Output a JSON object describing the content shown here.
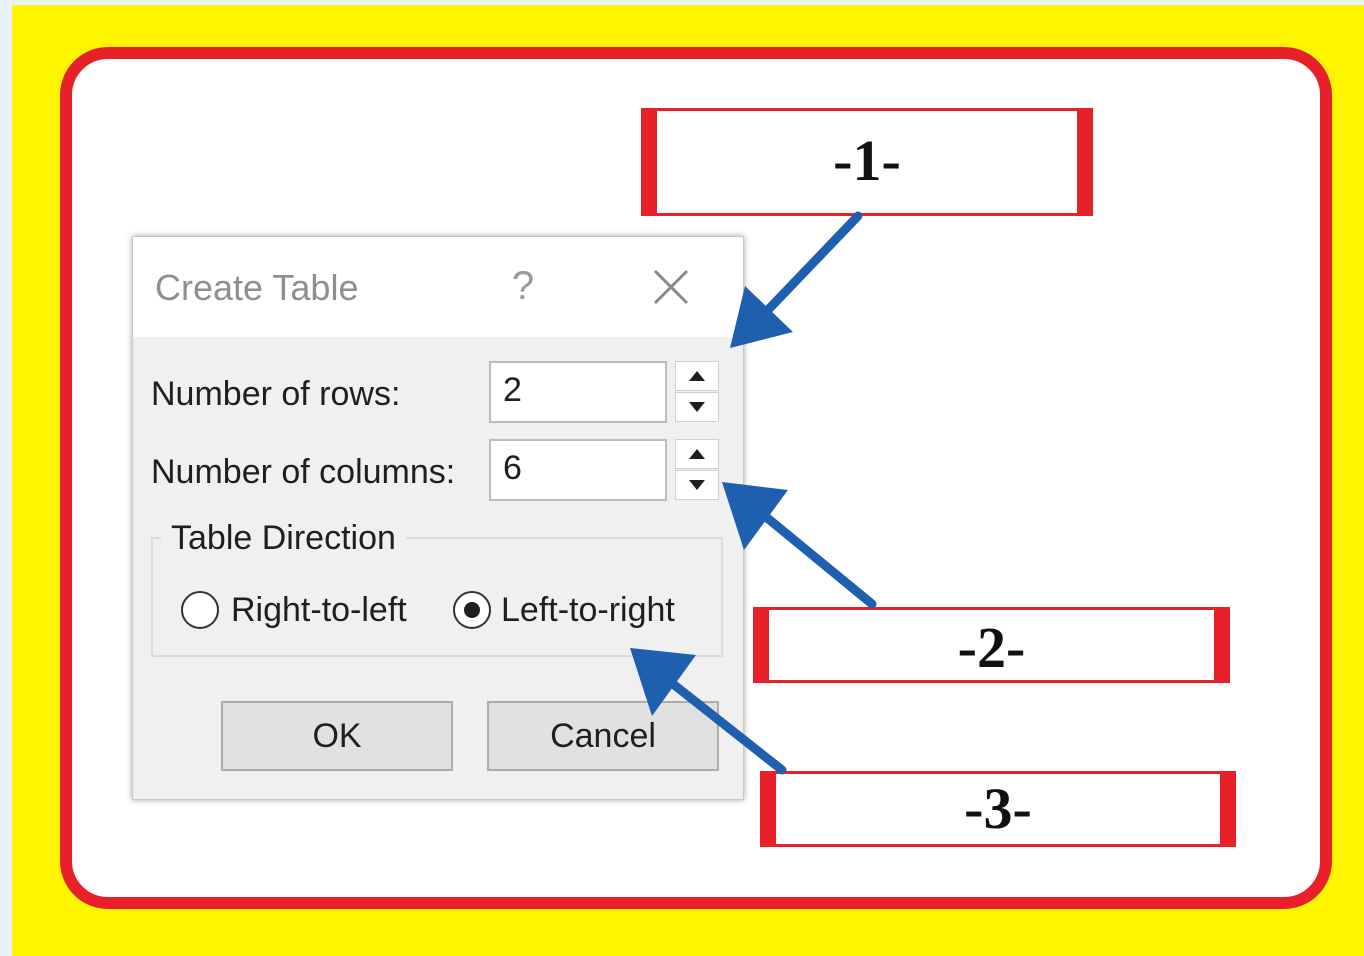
{
  "dialog": {
    "title": "Create Table",
    "help_label": "?",
    "rows_label": "Number of rows:",
    "rows_value": "2",
    "columns_label": "Number of columns:",
    "columns_value": "6",
    "direction_group_label": "Table Direction",
    "rtl_label": "Right-to-left",
    "ltr_label": "Left-to-right",
    "selected_direction": "Left-to-right",
    "ok_label": "OK",
    "cancel_label": "Cancel"
  },
  "callouts": {
    "one": "-1-",
    "two": "-2-",
    "three": "-3-"
  },
  "colors": {
    "background": "#fff500",
    "border_red": "#e8202a",
    "arrow_blue": "#1f5fb0"
  },
  "icons": [
    "close-icon",
    "spin-up-icon",
    "spin-down-icon",
    "arrow-icon"
  ]
}
